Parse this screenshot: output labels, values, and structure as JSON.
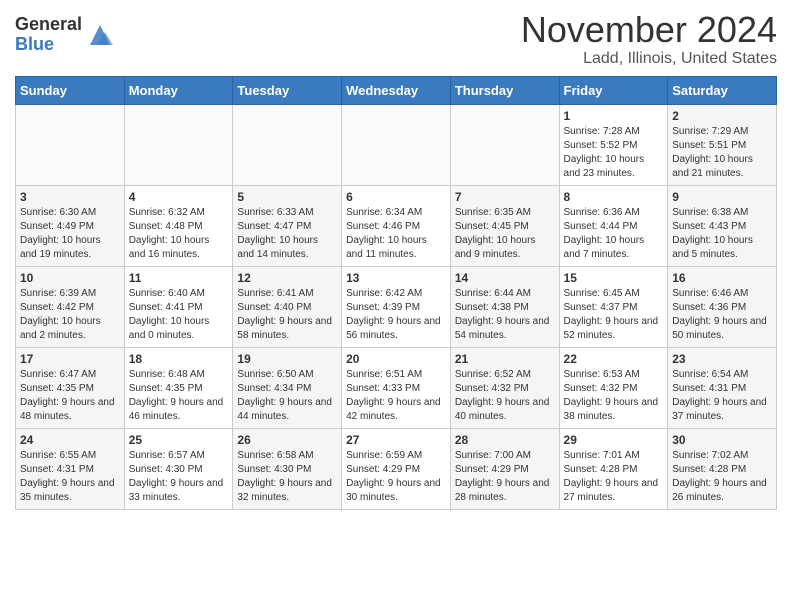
{
  "header": {
    "logo_general": "General",
    "logo_blue": "Blue",
    "month_title": "November 2024",
    "location": "Ladd, Illinois, United States"
  },
  "days_of_week": [
    "Sunday",
    "Monday",
    "Tuesday",
    "Wednesday",
    "Thursday",
    "Friday",
    "Saturday"
  ],
  "weeks": [
    [
      {
        "day": "",
        "info": ""
      },
      {
        "day": "",
        "info": ""
      },
      {
        "day": "",
        "info": ""
      },
      {
        "day": "",
        "info": ""
      },
      {
        "day": "",
        "info": ""
      },
      {
        "day": "1",
        "info": "Sunrise: 7:28 AM\nSunset: 5:52 PM\nDaylight: 10 hours and 23 minutes."
      },
      {
        "day": "2",
        "info": "Sunrise: 7:29 AM\nSunset: 5:51 PM\nDaylight: 10 hours and 21 minutes."
      }
    ],
    [
      {
        "day": "3",
        "info": "Sunrise: 6:30 AM\nSunset: 4:49 PM\nDaylight: 10 hours and 19 minutes."
      },
      {
        "day": "4",
        "info": "Sunrise: 6:32 AM\nSunset: 4:48 PM\nDaylight: 10 hours and 16 minutes."
      },
      {
        "day": "5",
        "info": "Sunrise: 6:33 AM\nSunset: 4:47 PM\nDaylight: 10 hours and 14 minutes."
      },
      {
        "day": "6",
        "info": "Sunrise: 6:34 AM\nSunset: 4:46 PM\nDaylight: 10 hours and 11 minutes."
      },
      {
        "day": "7",
        "info": "Sunrise: 6:35 AM\nSunset: 4:45 PM\nDaylight: 10 hours and 9 minutes."
      },
      {
        "day": "8",
        "info": "Sunrise: 6:36 AM\nSunset: 4:44 PM\nDaylight: 10 hours and 7 minutes."
      },
      {
        "day": "9",
        "info": "Sunrise: 6:38 AM\nSunset: 4:43 PM\nDaylight: 10 hours and 5 minutes."
      }
    ],
    [
      {
        "day": "10",
        "info": "Sunrise: 6:39 AM\nSunset: 4:42 PM\nDaylight: 10 hours and 2 minutes."
      },
      {
        "day": "11",
        "info": "Sunrise: 6:40 AM\nSunset: 4:41 PM\nDaylight: 10 hours and 0 minutes."
      },
      {
        "day": "12",
        "info": "Sunrise: 6:41 AM\nSunset: 4:40 PM\nDaylight: 9 hours and 58 minutes."
      },
      {
        "day": "13",
        "info": "Sunrise: 6:42 AM\nSunset: 4:39 PM\nDaylight: 9 hours and 56 minutes."
      },
      {
        "day": "14",
        "info": "Sunrise: 6:44 AM\nSunset: 4:38 PM\nDaylight: 9 hours and 54 minutes."
      },
      {
        "day": "15",
        "info": "Sunrise: 6:45 AM\nSunset: 4:37 PM\nDaylight: 9 hours and 52 minutes."
      },
      {
        "day": "16",
        "info": "Sunrise: 6:46 AM\nSunset: 4:36 PM\nDaylight: 9 hours and 50 minutes."
      }
    ],
    [
      {
        "day": "17",
        "info": "Sunrise: 6:47 AM\nSunset: 4:35 PM\nDaylight: 9 hours and 48 minutes."
      },
      {
        "day": "18",
        "info": "Sunrise: 6:48 AM\nSunset: 4:35 PM\nDaylight: 9 hours and 46 minutes."
      },
      {
        "day": "19",
        "info": "Sunrise: 6:50 AM\nSunset: 4:34 PM\nDaylight: 9 hours and 44 minutes."
      },
      {
        "day": "20",
        "info": "Sunrise: 6:51 AM\nSunset: 4:33 PM\nDaylight: 9 hours and 42 minutes."
      },
      {
        "day": "21",
        "info": "Sunrise: 6:52 AM\nSunset: 4:32 PM\nDaylight: 9 hours and 40 minutes."
      },
      {
        "day": "22",
        "info": "Sunrise: 6:53 AM\nSunset: 4:32 PM\nDaylight: 9 hours and 38 minutes."
      },
      {
        "day": "23",
        "info": "Sunrise: 6:54 AM\nSunset: 4:31 PM\nDaylight: 9 hours and 37 minutes."
      }
    ],
    [
      {
        "day": "24",
        "info": "Sunrise: 6:55 AM\nSunset: 4:31 PM\nDaylight: 9 hours and 35 minutes."
      },
      {
        "day": "25",
        "info": "Sunrise: 6:57 AM\nSunset: 4:30 PM\nDaylight: 9 hours and 33 minutes."
      },
      {
        "day": "26",
        "info": "Sunrise: 6:58 AM\nSunset: 4:30 PM\nDaylight: 9 hours and 32 minutes."
      },
      {
        "day": "27",
        "info": "Sunrise: 6:59 AM\nSunset: 4:29 PM\nDaylight: 9 hours and 30 minutes."
      },
      {
        "day": "28",
        "info": "Sunrise: 7:00 AM\nSunset: 4:29 PM\nDaylight: 9 hours and 28 minutes."
      },
      {
        "day": "29",
        "info": "Sunrise: 7:01 AM\nSunset: 4:28 PM\nDaylight: 9 hours and 27 minutes."
      },
      {
        "day": "30",
        "info": "Sunrise: 7:02 AM\nSunset: 4:28 PM\nDaylight: 9 hours and 26 minutes."
      }
    ]
  ]
}
